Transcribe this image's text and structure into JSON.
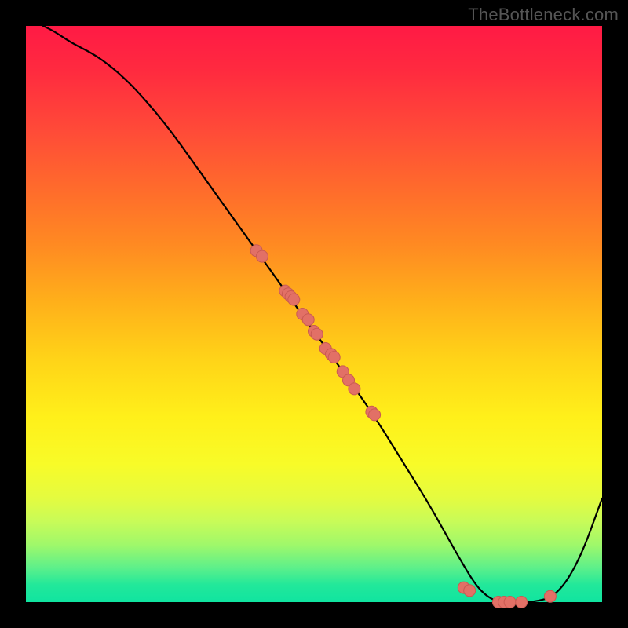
{
  "watermark": "TheBottleneck.com",
  "colors": {
    "curve": "#000000",
    "point_fill": "#e27066",
    "point_stroke": "#c95a52",
    "frame": "#000000"
  },
  "chart_data": {
    "type": "line",
    "title": "",
    "xlabel": "",
    "ylabel": "",
    "xlim": [
      0,
      100
    ],
    "ylim": [
      0,
      100
    ],
    "grid": false,
    "series": [
      {
        "name": "bottleneck-curve",
        "x": [
          3,
          5,
          8,
          12,
          16,
          20,
          25,
          30,
          35,
          40,
          45,
          50,
          55,
          60,
          65,
          70,
          75,
          78,
          80,
          82,
          85,
          88,
          92,
          96,
          100
        ],
        "y": [
          100,
          99,
          97,
          95,
          92,
          88,
          82,
          75,
          68,
          61,
          54,
          47,
          40,
          33,
          25,
          17,
          8,
          3,
          1,
          0,
          0,
          0,
          1,
          7,
          18
        ]
      }
    ],
    "scatter_points": {
      "name": "highlighted-values",
      "x": [
        40,
        41,
        45,
        45.5,
        46,
        46.5,
        48,
        49,
        50,
        50.5,
        52,
        53,
        53.5,
        55,
        56,
        57,
        60,
        60.5,
        76,
        77,
        82,
        83,
        84,
        86,
        91
      ],
      "y": [
        61,
        60,
        54,
        53.5,
        53,
        52.5,
        50,
        49,
        47,
        46.5,
        44,
        43,
        42.5,
        40,
        38.5,
        37,
        33,
        32.5,
        2.5,
        2,
        0,
        0,
        0,
        0,
        1
      ]
    }
  }
}
